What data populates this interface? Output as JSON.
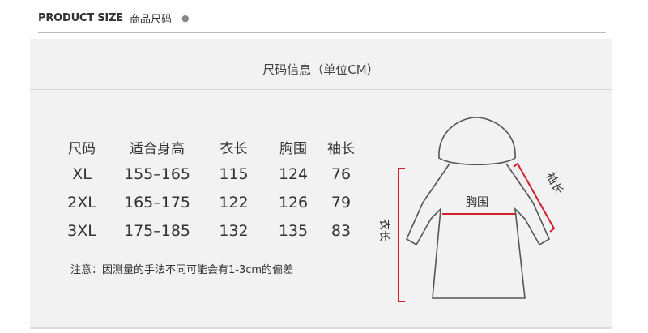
{
  "header": {
    "en_label": "PRODUCT SIZE",
    "cn_label": "商品尺码",
    "dot": "●"
  },
  "panel": {
    "title": "尺码信息（单位CM）"
  },
  "table": {
    "headers": [
      "尺码",
      "适合身高",
      "衣长",
      "胸围",
      "袖长"
    ],
    "rows": [
      [
        "XL",
        "155–165",
        "115",
        "124",
        "76"
      ],
      [
        "2XL",
        "165–175",
        "122",
        "126",
        "79"
      ],
      [
        "3XL",
        "175–185",
        "132",
        "135",
        "83"
      ]
    ]
  },
  "note": "注意：因测量的手法不同可能会有1-3cm的偏差",
  "diagram": {
    "chest_label": "胸围",
    "length_label": "衣长",
    "sleeve_label": "袖长",
    "marker_color": "#d0202a"
  }
}
